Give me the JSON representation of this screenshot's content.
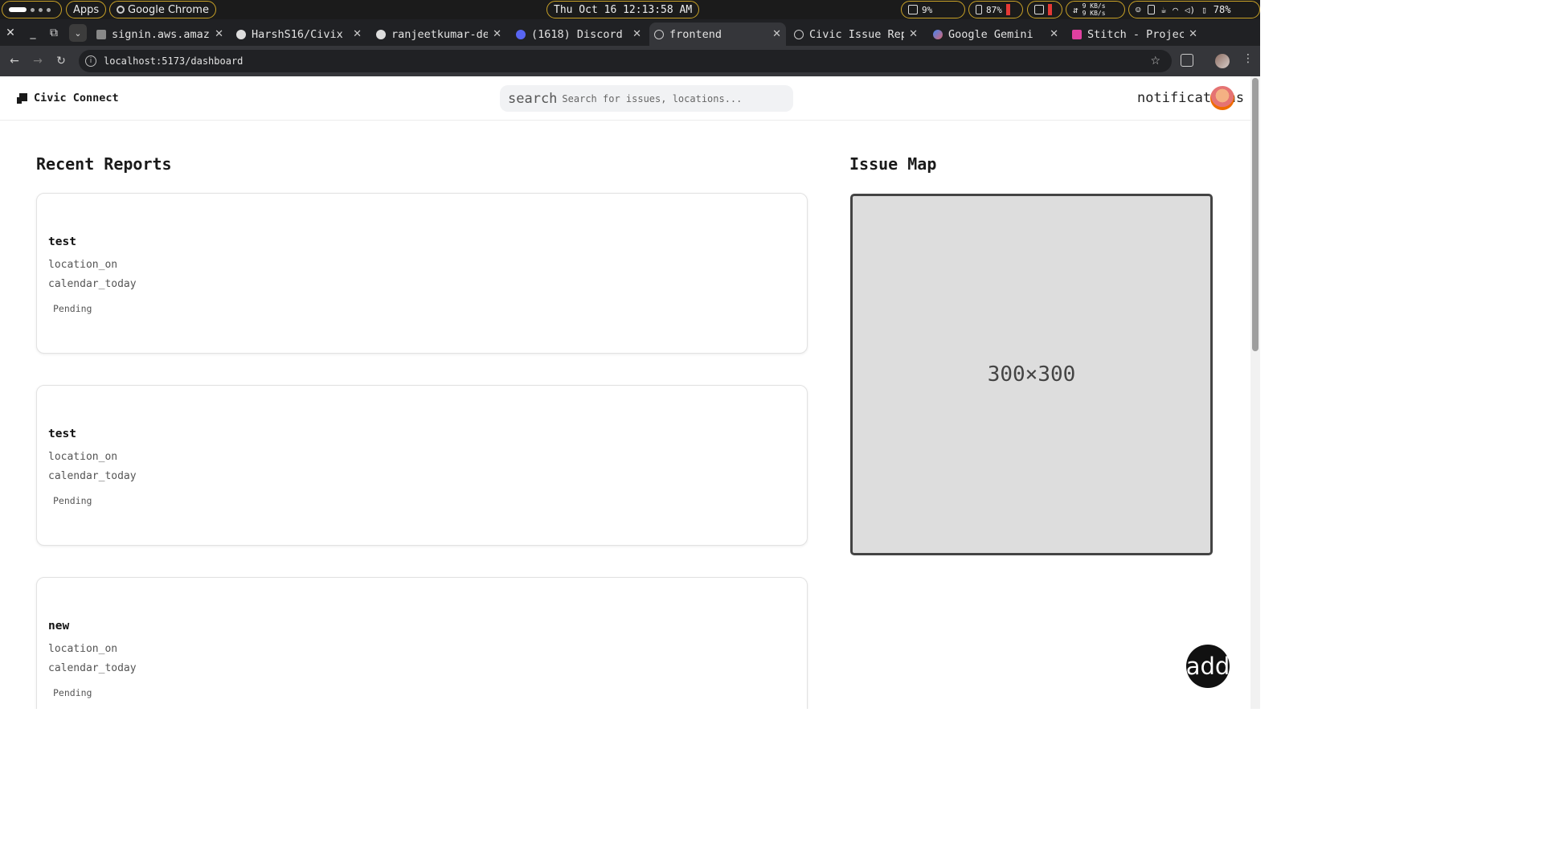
{
  "system_bar": {
    "apps_label": "Apps",
    "active_app": "Google Chrome",
    "clock": "Thu Oct 16 12:13:58 AM",
    "cpu": "9%",
    "memory": "87%",
    "net_up": "9 KB/s",
    "net_down": "9 KB/s",
    "battery": "78%"
  },
  "tabs": [
    {
      "title": "signin.aws.amazon",
      "icon": "aws-icon"
    },
    {
      "title": "HarshS16/Civix",
      "icon": "github-icon"
    },
    {
      "title": "ranjeetkumar-de",
      "icon": "github-icon"
    },
    {
      "title": "(1618) Discord",
      "icon": "discord-icon"
    },
    {
      "title": "frontend",
      "icon": "globe-icon",
      "active": true
    },
    {
      "title": "Civic Issue Rep",
      "icon": "globe-icon"
    },
    {
      "title": "Google Gemini",
      "icon": "gemini-icon"
    },
    {
      "title": "Stitch - Projects",
      "icon": "stitch-icon"
    }
  ],
  "address_bar": {
    "url": "localhost:5173/dashboard"
  },
  "app": {
    "brand": "Civic Connect",
    "search_icon_text": "search",
    "search_placeholder": "Search for issues, locations...",
    "notifications_icon_text": "notifications",
    "fab_label": "add"
  },
  "recent_reports": {
    "heading": "Recent Reports",
    "items": [
      {
        "title": "test",
        "location_icon": "location_on",
        "date_icon": "calendar_today",
        "status": "Pending"
      },
      {
        "title": "test",
        "location_icon": "location_on",
        "date_icon": "calendar_today",
        "status": "Pending"
      },
      {
        "title": "new",
        "location_icon": "location_on",
        "date_icon": "calendar_today",
        "status": "Pending"
      }
    ]
  },
  "issue_map": {
    "heading": "Issue Map",
    "placeholder_text": "300×300"
  },
  "colors": {
    "accent_border": "#c9a227",
    "map_bg": "#dddddd",
    "fab_bg": "#111111"
  }
}
